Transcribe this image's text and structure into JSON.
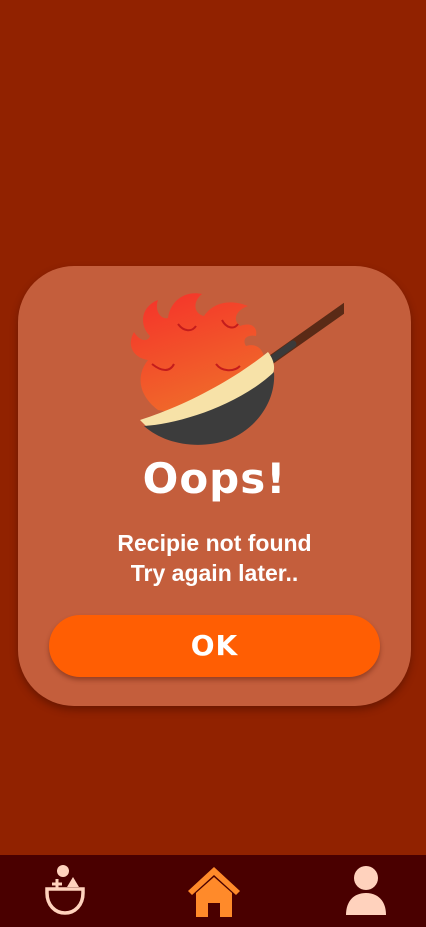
{
  "screen": {
    "background_color": "#912200"
  },
  "dialog": {
    "illustration_icon": "flaming-wok-icon",
    "title": "Oops!",
    "message_lines": [
      "Recipie not found",
      "Try again later.."
    ],
    "ok_label": "OK",
    "background_color": "#c45e3c",
    "button_color": "#ff5e03"
  },
  "bottom_nav": {
    "background_color": "#4a0000",
    "items": [
      {
        "icon": "ingredients-bowl-icon",
        "active": false
      },
      {
        "icon": "home-icon",
        "active": true
      },
      {
        "icon": "profile-icon",
        "active": false
      }
    ],
    "active_color": "#ff8a2a",
    "inactive_color": "#ffd2bd"
  }
}
